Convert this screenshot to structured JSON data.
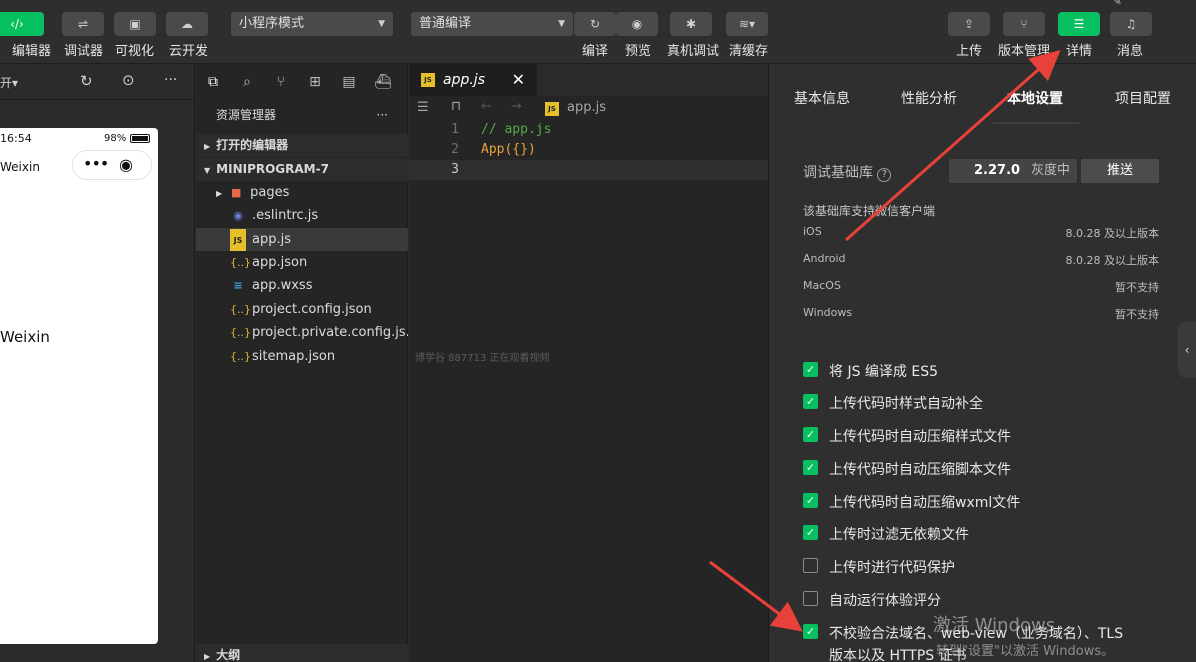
{
  "toolbar": {
    "editor_label": "编辑器",
    "debugger_label": "调试器",
    "visual_label": "可视化",
    "cloud_label": "云开发",
    "mode_select": "小程序模式",
    "compile_select": "普通编译",
    "compile_label": "编译",
    "preview_label": "预览",
    "device_debug_label": "真机调试",
    "clear_cache_label": "清缓存",
    "upload_label": "上传",
    "version_label": "版本管理",
    "details_label": "详情",
    "messages_label": "消息"
  },
  "simulator": {
    "dropdown_fragment": "开▾",
    "time": "16:54",
    "battery": "98%",
    "nav_title": "Weixin",
    "body_text": "Weixin"
  },
  "explorer": {
    "title": "资源管理器",
    "more": "···",
    "open_editors": "打开的编辑器",
    "project": "MINIPROGRAM-7",
    "files": [
      {
        "name": "pages",
        "icon": "folder"
      },
      {
        "name": ".eslintrc.js",
        "icon": "eslint"
      },
      {
        "name": "app.js",
        "icon": "js"
      },
      {
        "name": "app.json",
        "icon": "json"
      },
      {
        "name": "app.wxss",
        "icon": "css"
      },
      {
        "name": "project.config.json",
        "icon": "json"
      },
      {
        "name": "project.private.config.js...",
        "icon": "json"
      },
      {
        "name": "sitemap.json",
        "icon": "json"
      }
    ],
    "outline": "大纲"
  },
  "editor": {
    "tab_name": "app.js",
    "breadcrumb_file": "app.js",
    "lines": [
      {
        "num": "1",
        "text": "// app.js",
        "color": "#57a64a"
      },
      {
        "num": "2",
        "text": "App({})",
        "color": "#e9a23b"
      },
      {
        "num": "3",
        "text": "",
        "color": "#d4d4d4"
      }
    ],
    "live_notice": "博学谷 887713 正在观看视频"
  },
  "details": {
    "tabs": [
      "基本信息",
      "性能分析",
      "本地设置",
      "项目配置"
    ],
    "active_tab": 2,
    "lib_label": "调试基础库",
    "lib_version": "2.27.0",
    "lib_status": "灰度中",
    "push_button": "推送",
    "support_title": "该基础库支持微信客户端",
    "support": [
      {
        "os": "iOS",
        "value": "8.0.28 及以上版本"
      },
      {
        "os": "Android",
        "value": "8.0.28 及以上版本"
      },
      {
        "os": "MacOS",
        "value": "暂不支持"
      },
      {
        "os": "Windows",
        "value": "暂不支持"
      }
    ],
    "options": [
      {
        "label": "将 JS 编译成 ES5",
        "checked": true
      },
      {
        "label": "上传代码时样式自动补全",
        "checked": true
      },
      {
        "label": "上传代码时自动压缩样式文件",
        "checked": true
      },
      {
        "label": "上传代码时自动压缩脚本文件",
        "checked": true
      },
      {
        "label": "上传代码时自动压缩wxml文件",
        "checked": true
      },
      {
        "label": "上传时过滤无依赖文件",
        "checked": true
      },
      {
        "label": "上传时进行代码保护",
        "checked": false
      },
      {
        "label": "自动运行体验评分",
        "checked": false
      },
      {
        "label": "不校验合法域名、web-view（业务域名）、TLS",
        "checked": true
      }
    ],
    "option_last_line2": "版本以及 HTTPS 证书"
  },
  "watermark": {
    "line1": "激活 Windows",
    "line2": "转到\"设置\"以激活 Windows。"
  },
  "colors": {
    "accent": "#07c160",
    "arrow": "#e8413a"
  }
}
